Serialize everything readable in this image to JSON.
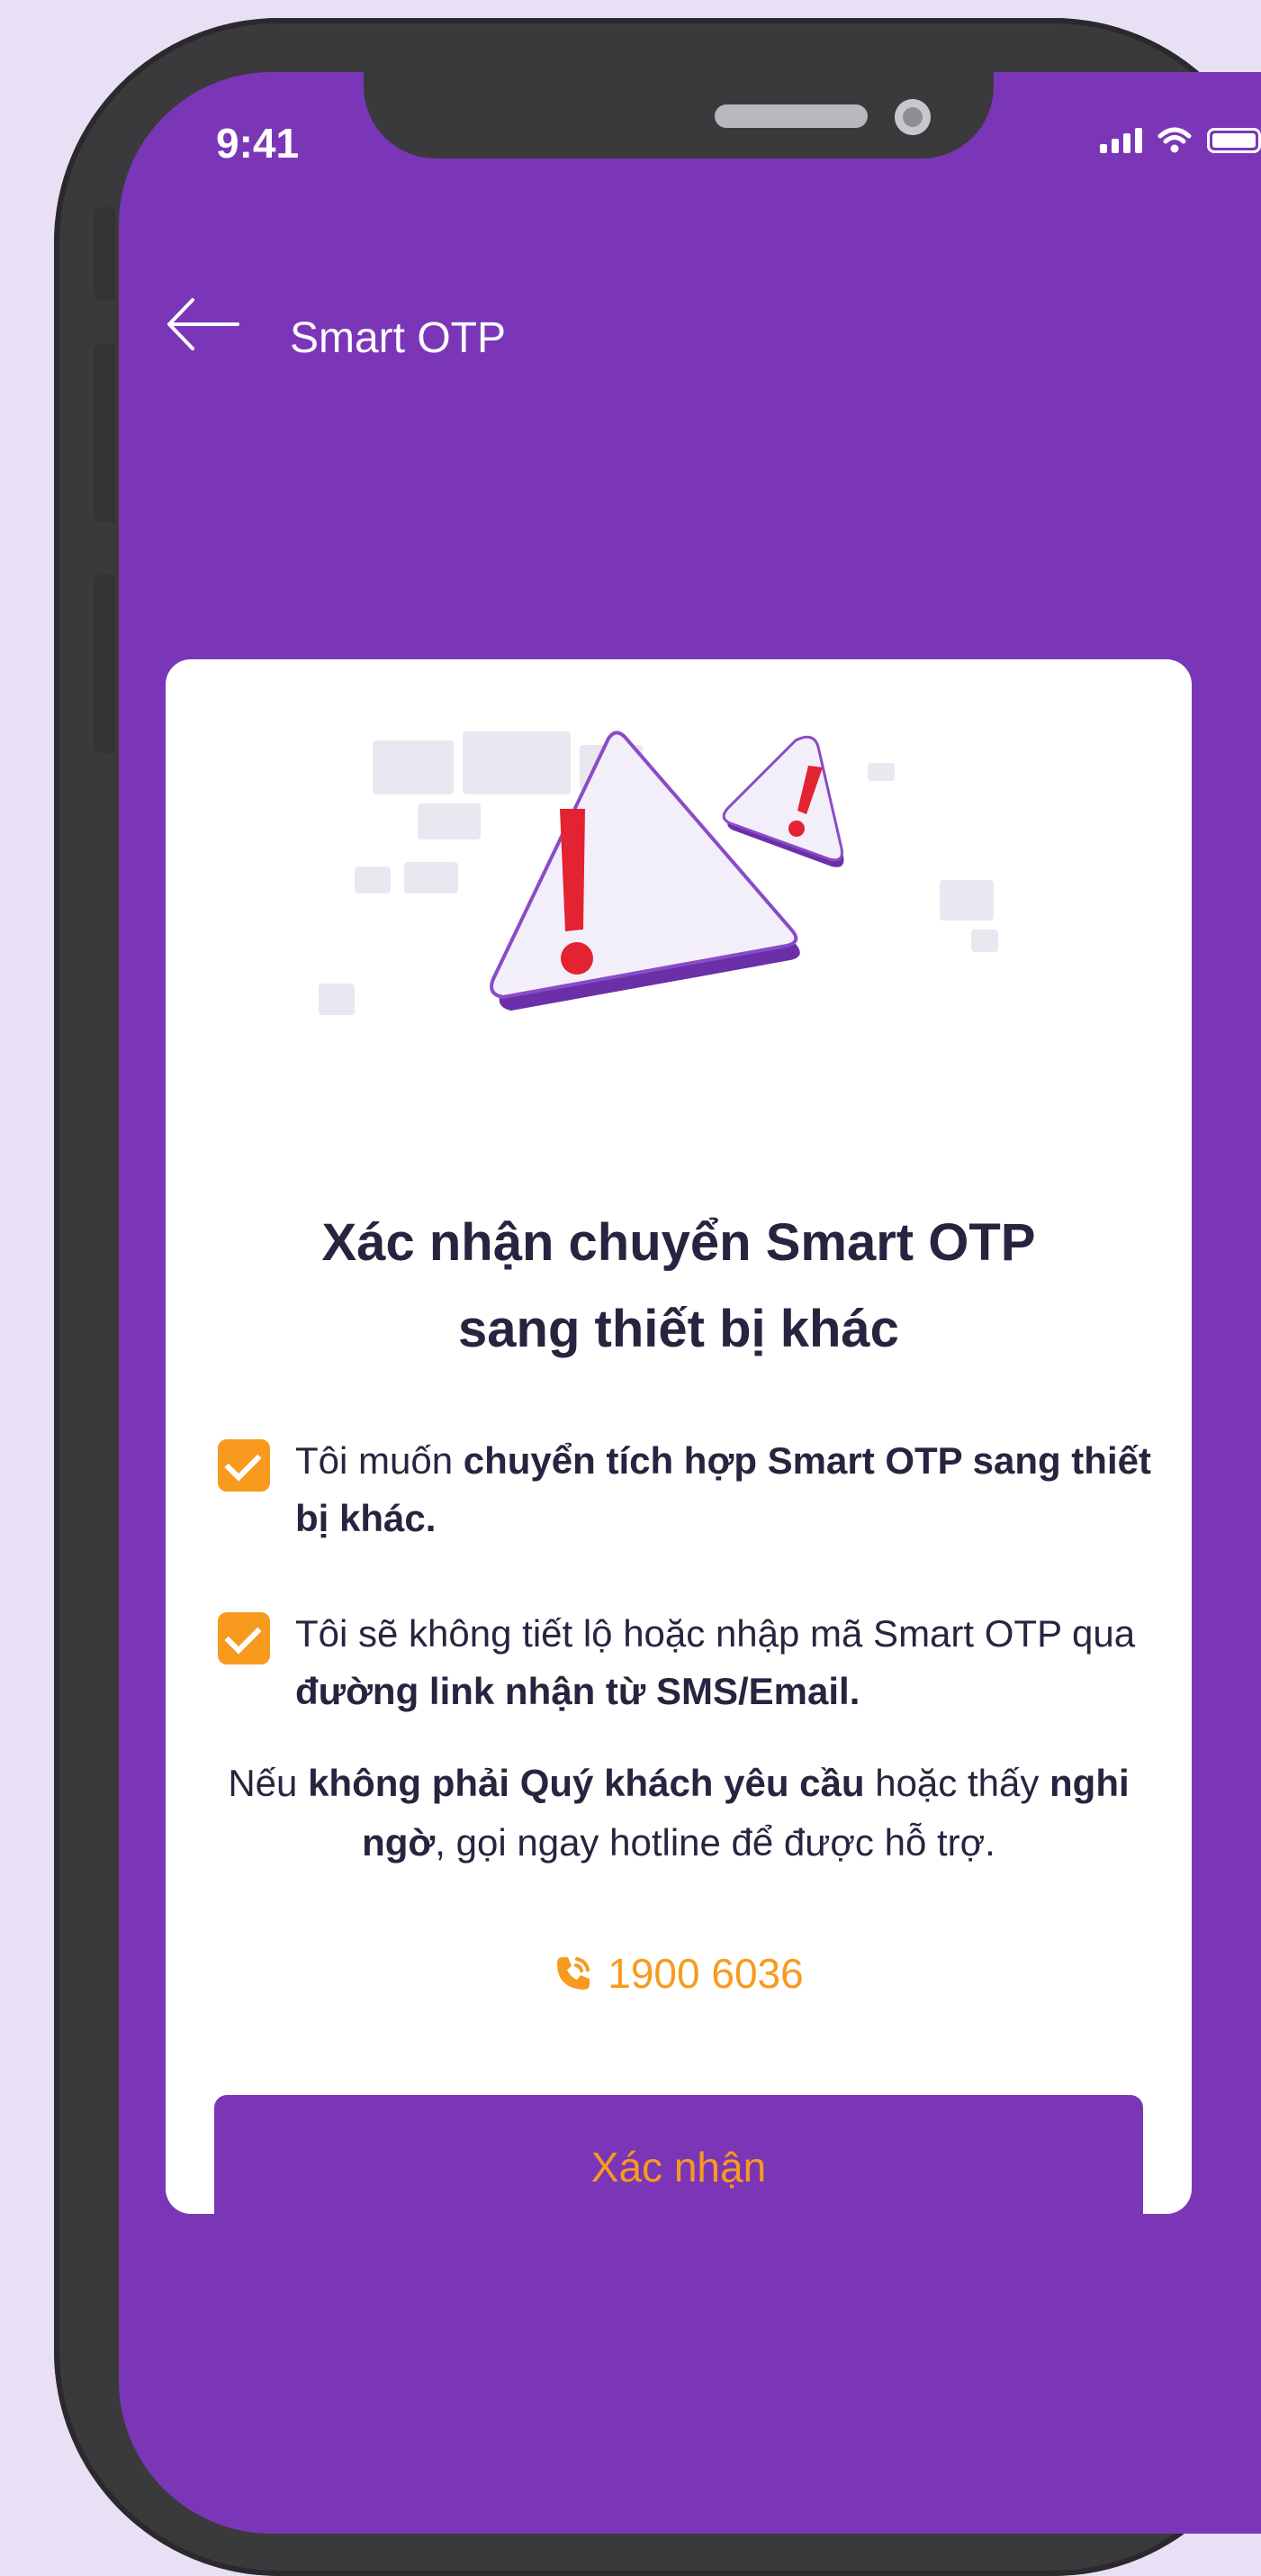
{
  "status_bar": {
    "time": "9:41"
  },
  "nav": {
    "title": "Smart OTP"
  },
  "card": {
    "title_line1": "Xác nhận chuyển Smart OTP",
    "title_line2": "sang thiết bị khác",
    "checks": [
      {
        "checked": true,
        "text_plain": "Tôi muốn ",
        "text_bold": "chuyển tích hợp Smart OTP sang thiết bị khác.",
        "text_tail": ""
      },
      {
        "checked": true,
        "text_plain": "Tôi sẽ không tiết lộ hoặc nhập mã Smart OTP qua ",
        "text_bold": "đường link nhận từ SMS/Email.",
        "text_tail": ""
      }
    ],
    "note": {
      "p1": "Nếu ",
      "b1": "không phải Quý khách yêu cầu",
      "p2": " hoặc thấy ",
      "b2": "nghi ngờ",
      "p3": ", gọi ngay hotline để được hỗ trợ."
    },
    "hotline": "1900 6036",
    "confirm_label": "Xác nhận"
  },
  "colors": {
    "primary": "#7b36b8",
    "accent": "#f79a1e",
    "alert_red": "#e32232",
    "text_dark": "#2a2340"
  },
  "icons": [
    "back-arrow-icon",
    "signal-icon",
    "wifi-icon",
    "battery-icon",
    "warning-triangle-icon",
    "checkbox-checked-icon",
    "phone-call-icon"
  ]
}
